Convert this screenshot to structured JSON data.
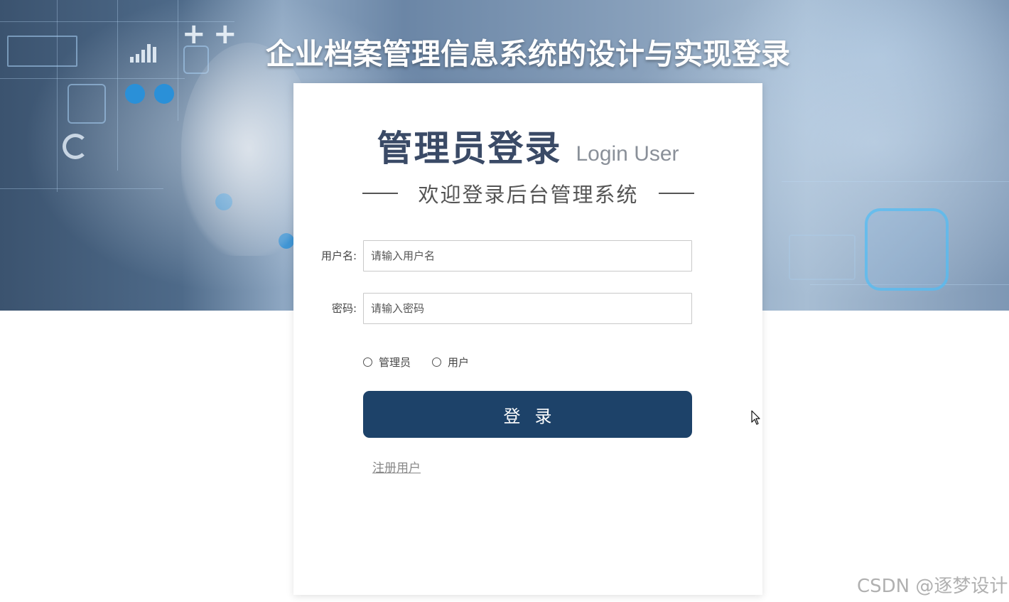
{
  "site": {
    "title": "企业档案管理信息系统的设计与实现登录"
  },
  "card": {
    "title": "管理员登录",
    "title_en": "Login User",
    "subtitle": "欢迎登录后台管理系统"
  },
  "form": {
    "username": {
      "label": "用户名:",
      "placeholder": "请输入用户名",
      "value": ""
    },
    "password": {
      "label": "密码:",
      "placeholder": "请输入密码",
      "value": ""
    },
    "roles": [
      {
        "label": "管理员",
        "selected": false
      },
      {
        "label": "用户",
        "selected": false
      }
    ],
    "login_label": "登录",
    "register_label": "注册用户"
  },
  "watermark": "CSDN @逐梦设计",
  "colors": {
    "primary_button": "#1d4269",
    "card_title": "#3a4a66",
    "hero_blue": "#4e6a89"
  }
}
